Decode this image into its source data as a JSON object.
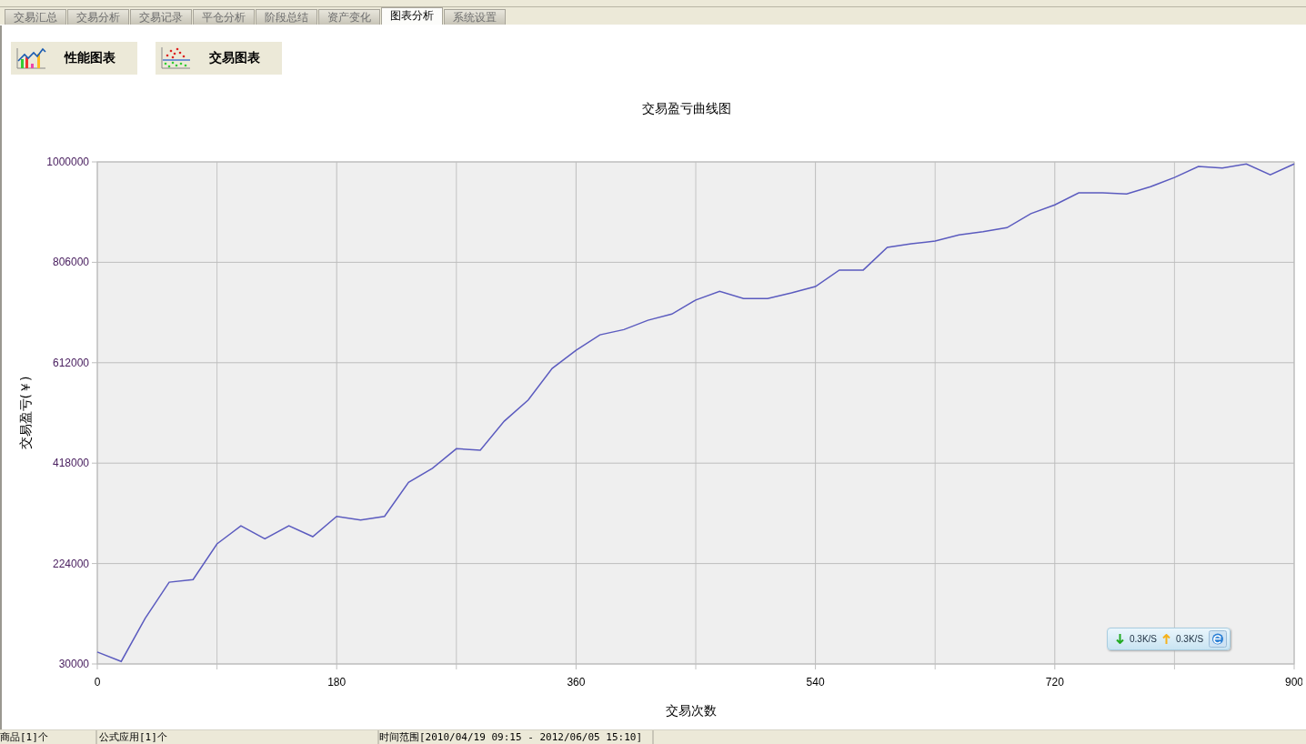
{
  "tabs": [
    {
      "label": "交易汇总",
      "selected": false
    },
    {
      "label": "交易分析",
      "selected": false
    },
    {
      "label": "交易记录",
      "selected": false
    },
    {
      "label": "平仓分析",
      "selected": false
    },
    {
      "label": "阶段总结",
      "selected": false
    },
    {
      "label": "资产变化",
      "selected": false
    },
    {
      "label": "图表分析",
      "selected": true
    },
    {
      "label": "系统设置",
      "selected": false
    }
  ],
  "chart_buttons": [
    {
      "kind": "performance",
      "label": "性能图表"
    },
    {
      "kind": "trades",
      "label": "交易图表"
    }
  ],
  "chart": {
    "chart_data": {
      "type": "line",
      "title": "交易盈亏曲线图",
      "xlabel": "交易次数",
      "ylabel": "交易盈亏(￥)",
      "x": [
        0,
        18,
        36,
        54,
        72,
        90,
        108,
        126,
        144,
        162,
        180,
        198,
        216,
        234,
        252,
        270,
        288,
        306,
        324,
        342,
        360,
        378,
        396,
        414,
        432,
        450,
        468,
        486,
        504,
        522,
        540,
        558,
        576,
        594,
        612,
        630,
        648,
        666,
        684,
        702,
        720,
        738,
        756,
        774,
        792,
        810,
        828,
        846,
        864,
        882,
        900
      ],
      "grid": true,
      "series": [
        {
          "color": "#5b5bbf",
          "values": [
            53000,
            35000,
            118000,
            188000,
            193000,
            262000,
            297000,
            272000,
            297000,
            276000,
            315000,
            308000,
            315000,
            381000,
            408000,
            446000,
            443000,
            499000,
            540000,
            601000,
            636000,
            666000,
            676000,
            694000,
            706000,
            733000,
            750000,
            736000,
            736000,
            747000,
            759000,
            791000,
            791000,
            835000,
            842000,
            847000,
            859000,
            865000,
            873000,
            900000,
            917000,
            940000,
            940000,
            938000,
            952000,
            970000,
            991000,
            988000,
            996000,
            975000,
            996000
          ]
        }
      ],
      "xlim": [
        0,
        900
      ],
      "ylim": [
        30000,
        1000000
      ],
      "xticks": [
        0,
        180,
        360,
        540,
        720,
        900
      ],
      "yticks": [
        30000,
        224000,
        418000,
        612000,
        806000,
        1000000
      ]
    }
  },
  "network_widget": {
    "download": "0.3K/S",
    "upload": "0.3K/S"
  },
  "status_bar": [
    "商品[1]个",
    "公式应用[1]个",
    "时间范围[2010/04/19 09:15 - 2012/06/05 15:10]"
  ]
}
